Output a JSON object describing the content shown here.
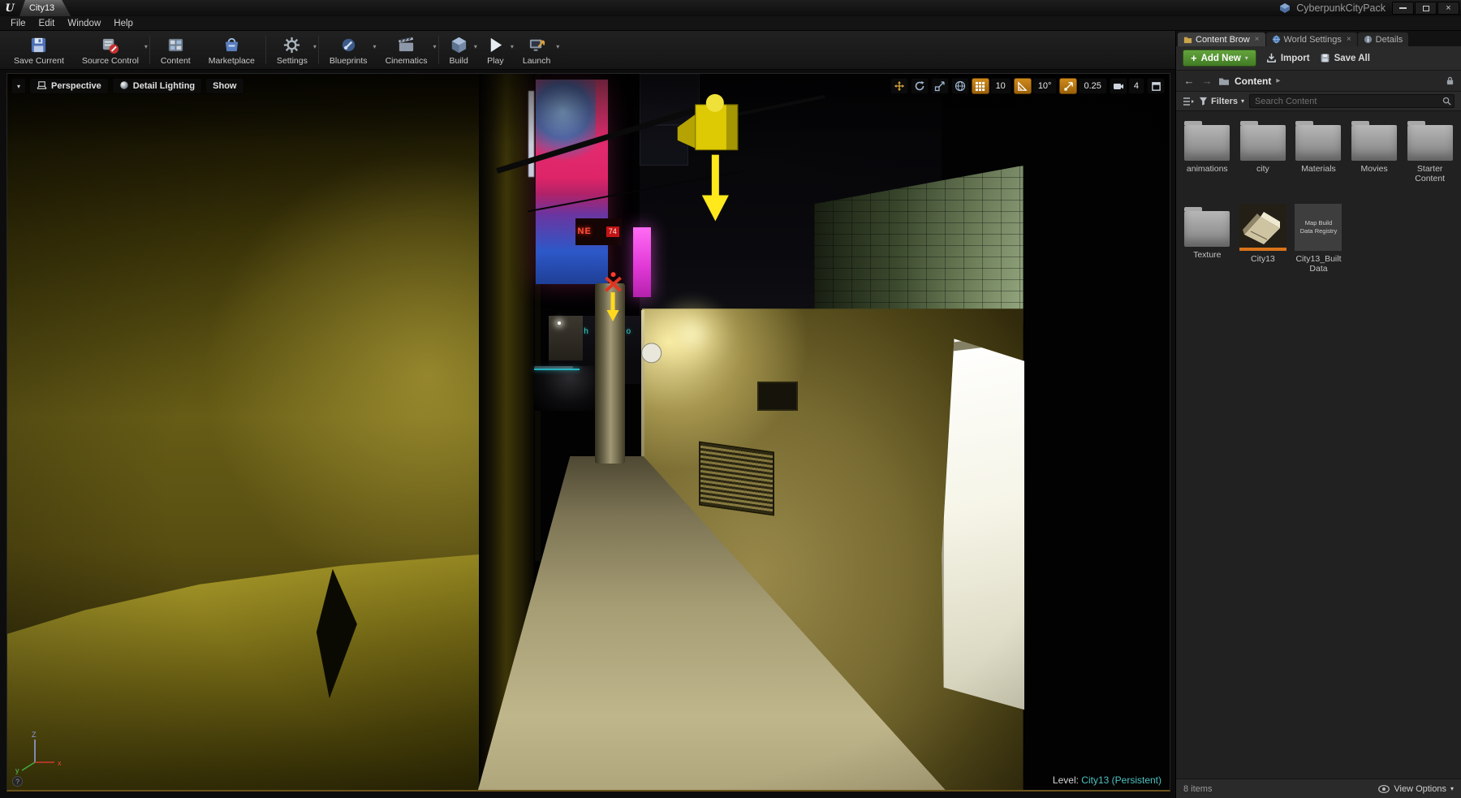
{
  "window": {
    "logo": "U",
    "tab_title": "City13",
    "project_name": "CyberpunkCityPack"
  },
  "menu": {
    "items": [
      "File",
      "Edit",
      "Window",
      "Help"
    ]
  },
  "glyphs": {
    "caret_down": "▾",
    "caret_right": "▸",
    "back_arrow": "←",
    "forward_arrow": "→",
    "close": "×",
    "plus": "+",
    "question": "?"
  },
  "toolbar": {
    "buttons": [
      {
        "label": "Save Current"
      },
      {
        "label": "Source Control"
      },
      {
        "label": "Content"
      },
      {
        "label": "Marketplace"
      },
      {
        "label": "Settings"
      },
      {
        "label": "Blueprints"
      },
      {
        "label": "Cinematics"
      },
      {
        "label": "Build"
      },
      {
        "label": "Play"
      },
      {
        "label": "Launch"
      }
    ]
  },
  "viewport": {
    "perspective": "Perspective",
    "lighting": "Detail Lighting",
    "show": "Show",
    "snaps": {
      "grid": "10",
      "rotation": "10°",
      "scale": "0.25",
      "camera_speed": "4"
    },
    "level_label": "Level:",
    "level_value": "City13 (Persistent)",
    "axis": {
      "x": "x",
      "y": "y",
      "z": "Z"
    }
  },
  "scene": {
    "neon_left": "NE",
    "neon_right": "74",
    "distant_sign": "h o f o",
    "tiny_sign": "x!"
  },
  "content_browser": {
    "tabs": [
      {
        "label": "Content Brow"
      },
      {
        "label": "World Settings"
      },
      {
        "label": "Details"
      }
    ],
    "actions": {
      "add_new": "Add New",
      "import": "Import",
      "save_all": "Save All"
    },
    "path": "Content",
    "filters_label": "Filters",
    "search_placeholder": "Search Content",
    "items": [
      {
        "name": "animations"
      },
      {
        "name": "city"
      },
      {
        "name": "Materials"
      },
      {
        "name": "Movies"
      },
      {
        "name": "Starter Content"
      },
      {
        "name": "Texture"
      },
      {
        "name": "City13"
      },
      {
        "name": "City13_Built Data",
        "thumb_text": "Map Build Data Registry"
      }
    ],
    "status": {
      "count": "8 items",
      "view_options": "View Options"
    }
  },
  "colors": {
    "accent_orange": "#c98312",
    "add_new_green": "#4e9130",
    "level_teal": "#4fc1c1",
    "asset_map_bar": "#d9731a",
    "neon_pink": "#f23277",
    "neon_magenta": "#e14ce1"
  }
}
